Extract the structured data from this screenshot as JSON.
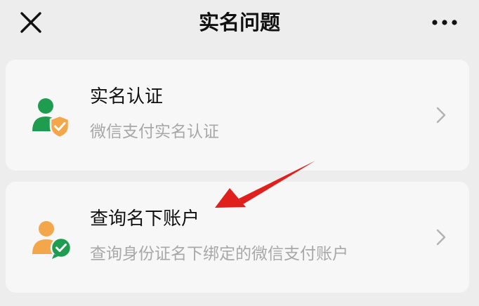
{
  "nav": {
    "title": "实名问题",
    "close_icon": "close-icon",
    "more_icon": "more-icon"
  },
  "cards": [
    {
      "title": "实名认证",
      "description": "微信支付实名认证",
      "icon": "user-shield-icon",
      "icon_colors": {
        "person": "#1f9d4e",
        "badge": "#f3a64a"
      }
    },
    {
      "title": "查询名下账户",
      "description": "查询身份证名下绑定的微信支付账户",
      "icon": "user-check-icon",
      "icon_colors": {
        "person": "#f3a64a",
        "badge": "#1f9d4e"
      }
    }
  ],
  "annotation": {
    "type": "arrow",
    "color": "#e0201c",
    "points_to": "查询名下账户"
  },
  "colors": {
    "background": "#ededed",
    "card": "#f7f7f7",
    "title_text": "#111111",
    "desc_text": "#a8a8a8"
  }
}
